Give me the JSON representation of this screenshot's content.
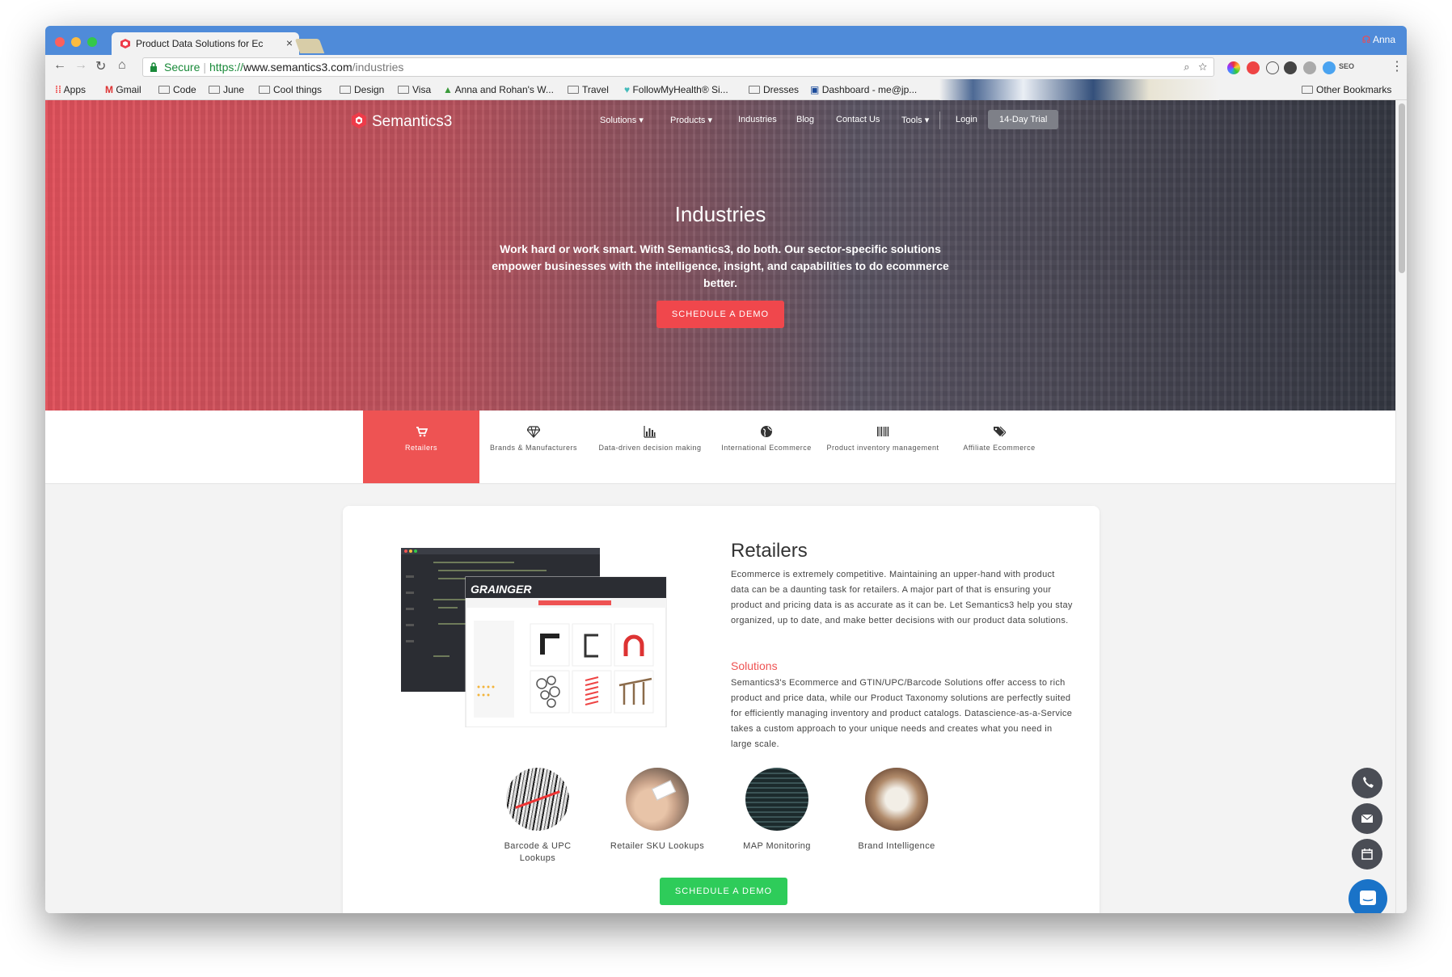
{
  "browser": {
    "tab_title": "Product Data Solutions for Ec",
    "profile": "Anna",
    "url": {
      "secure_label": "Secure",
      "scheme": "https://",
      "host": "www.semantics3.com",
      "path": "/industries"
    },
    "bookmarks": [
      {
        "label": "Apps",
        "icon": "apps-grid-icon"
      },
      {
        "label": "Gmail",
        "icon": "gmail-icon"
      },
      {
        "label": "Code",
        "icon": "folder-icon"
      },
      {
        "label": "June",
        "icon": "folder-icon"
      },
      {
        "label": "Cool things",
        "icon": "folder-icon"
      },
      {
        "label": "Design",
        "icon": "folder-icon"
      },
      {
        "label": "Visa",
        "icon": "folder-icon"
      },
      {
        "label": "Anna and Rohan's W...",
        "icon": "drive-icon"
      },
      {
        "label": "Travel",
        "icon": "folder-icon"
      },
      {
        "label": "FollowMyHealth® Si...",
        "icon": "heart-icon"
      },
      {
        "label": "Dresses",
        "icon": "folder-icon"
      },
      {
        "label": "Dashboard - me@jp...",
        "icon": "dashboard-icon"
      },
      {
        "label": "Other Bookmarks",
        "icon": "folder-icon"
      }
    ]
  },
  "site": {
    "logo": "Semantics3",
    "nav": [
      {
        "label": "Solutions",
        "dropdown": true
      },
      {
        "label": "Products",
        "dropdown": true
      },
      {
        "label": "Industries",
        "dropdown": false
      },
      {
        "label": "Blog",
        "dropdown": false
      },
      {
        "label": "Contact Us",
        "dropdown": false
      },
      {
        "label": "Tools",
        "dropdown": true
      },
      {
        "label": "Login",
        "dropdown": false
      }
    ],
    "trial_button": "14-Day Trial",
    "hero": {
      "title": "Industries",
      "subtitle": "Work hard or work smart. With Semantics3, do both. Our sector-specific solutions empower businesses with the intelligence, insight, and capabilities to do ecommerce better.",
      "cta": "SCHEDULE A DEMO"
    },
    "industry_tabs": [
      {
        "label": "Retailers",
        "icon": "cart-icon",
        "active": true
      },
      {
        "label": "Brands & Manufacturers",
        "icon": "diamond-icon",
        "active": false
      },
      {
        "label": "Data-driven decision making",
        "icon": "bar-chart-icon",
        "active": false
      },
      {
        "label": "International Ecommerce",
        "icon": "globe-icon",
        "active": false
      },
      {
        "label": "Product inventory management",
        "icon": "barcode-icon",
        "active": false
      },
      {
        "label": "Affiliate Ecommerce",
        "icon": "tags-icon",
        "active": false
      }
    ],
    "section": {
      "title": "Retailers",
      "intro": "Ecommerce is extremely competitive. Maintaining an upper-hand with product data can be a daunting task for retailers. A major part of that is ensuring your product and pricing data is as accurate as it can be. Let Semantics3 help you stay organized, up to date, and make better decisions with our product data solutions.",
      "solutions_heading": "Solutions",
      "solutions_text": "Semantics3's Ecommerce and GTIN/UPC/Barcode Solutions offer access to rich product and price data, while our Product Taxonomy solutions are perfectly suited for efficiently managing inventory and product catalogs. Datascience-as-a-Service takes a custom approach to your unique needs and creates what you need in large scale.",
      "mockup_brand": "GRAINGER",
      "features": [
        {
          "label": "Barcode & UPC Lookups",
          "image": "barcode-photo"
        },
        {
          "label": "Retailer SKU Lookups",
          "image": "sku-tag-photo"
        },
        {
          "label": "MAP Monitoring",
          "image": "price-board-photo"
        },
        {
          "label": "Brand Intelligence",
          "image": "workspace-photo"
        }
      ],
      "cta": "SCHEDULE A DEMO"
    },
    "float_buttons": [
      "phone-icon",
      "mail-icon",
      "calendar-icon",
      "chat-icon"
    ]
  },
  "colors": {
    "accent_red": "#ee5353",
    "cta_green": "#2ecc5a",
    "chrome_blue": "#4f8bd9",
    "secure_green": "#1a8a3a",
    "chat_blue": "#1a73c8"
  }
}
